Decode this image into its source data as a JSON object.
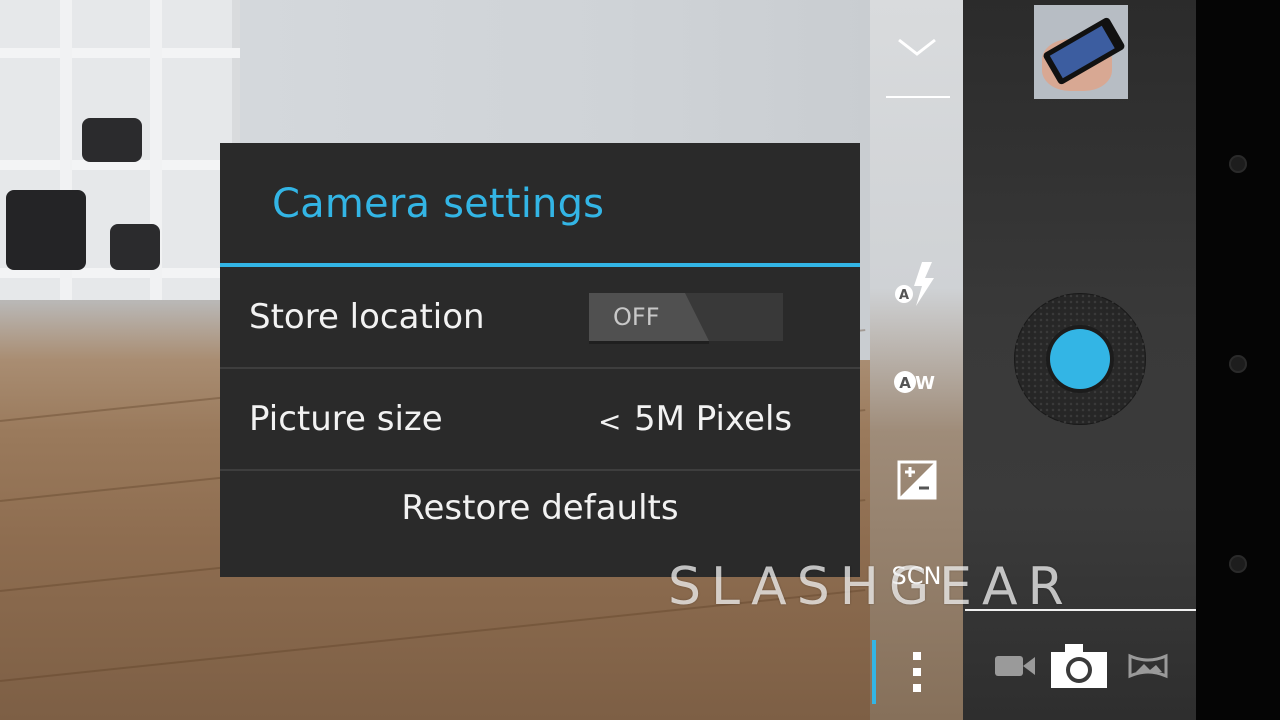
{
  "dialog": {
    "title": "Camera settings",
    "store_location": {
      "label": "Store location",
      "toggle_state": "OFF"
    },
    "picture_size": {
      "label": "Picture size",
      "arrow": "<",
      "value": "5M Pixels"
    },
    "restore_label": "Restore defaults"
  },
  "controls": {
    "awb_label": "AW",
    "scene_label": "SCN"
  },
  "watermark": "SLASHGEAR",
  "colors": {
    "accent": "#33b5e5",
    "dialog_bg": "#2a2a2a"
  },
  "icons": [
    "chevron-down-icon",
    "flash-auto-icon",
    "white-balance-icon",
    "exposure-icon",
    "more-options-icon",
    "video-camera-icon",
    "camera-icon",
    "panorama-icon"
  ]
}
